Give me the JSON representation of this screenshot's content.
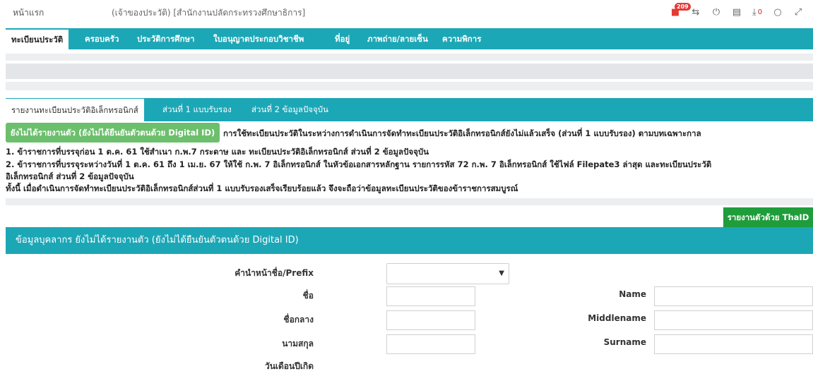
{
  "topbar": {
    "home": "หน้าแรก",
    "owner": "(เจ้าของประวัติ) [สำนักงานปลัดกระทรวงศึกษาธิการ]",
    "notif_count": "209",
    "download_count": "0"
  },
  "main_tabs": [
    "ทะเบียนประวัติ",
    "ครอบครัว",
    "ประวัติการศึกษา",
    "ใบอนุญาตประกอบวิชาชีพ",
    "ที่อยู่",
    "ภาพถ่าย/ลายเซ็น",
    "ความพิการ"
  ],
  "sub_tabs": [
    "รายงานทะเบียนประวัติอิเล็กทรอนิกส์",
    "ส่วนที่ 1 แบบรับรอง",
    "ส่วนที่ 2 ข้อมูลปัจจุบัน"
  ],
  "status_button": "ยังไม่ได้รายงานตัว (ยังไม่ได้ยืนยันตัวตนด้วย Digital ID)",
  "notice": "การใช้ทะเบียนประวัติในระหว่างการดำเนินการจัดทำทะเบียนประวัติอิเล็กทรอนิกส์ยังไม่แล้วเสร็จ (ส่วนที่ 1 แบบรับรอง) ตามบทเฉพาะกาล",
  "lines": [
    "1. ข้าราชการที่บรรจุก่อน 1 ต.ค. 61 ใช้สำเนา ก.พ.7 กระดาษ และ ทะเบียนประวัติอิเล็กทรอนิกส์ ส่วนที่ 2 ข้อมูลปัจจุบัน",
    "2. ข้าราชการที่บรรจุระหว่างวันที่ 1 ต.ค. 61 ถึง 1 เม.ย. 67 ให้ใช้ ก.พ. 7 อิเล็กทรอนิกส์ ในหัวข้อเอกสารหลักฐาน รายการรหัส 72 ก.พ. 7 อิเล็กทรอนิกส์ ใช้ไฟล์ Filepate3 ล่าสุด และทะเบียนประวัติ",
    "อิเล็กทรอนิกส์ ส่วนที่ 2 ข้อมูลปัจจุบัน",
    "ทั้งนี้ เมื่อดำเนินการจัดทำทะเบียนประวัติอิเล็กทรอนิกส์ส่วนที่ 1 แบบรับรองเสร็จเรียบร้อยแล้ว จึงจะถือว่าข้อมูลทะเบียนประวัติของข้าราชการสมบูรณ์"
  ],
  "thaid_button": "รายงานตัวด้วย ThaID",
  "panel_title": "ข้อมูลบุคลากร ยังไม่ได้รายงานตัว (ยังไม่ได้ยืนยันตัวตนด้วย Digital ID)",
  "form": {
    "prefix_label": "คำนำหน้าชื่อ/Prefix",
    "prefix_value": "",
    "name_th_label": "ชื่อ",
    "name_en_label": "Name",
    "middle_th_label": "ชื่อกลาง",
    "middle_en_label": "Middlename",
    "surname_th_label": "นามสกุล",
    "surname_en_label": "Surname",
    "dob_label": "วันเดือนปีเกิด"
  }
}
